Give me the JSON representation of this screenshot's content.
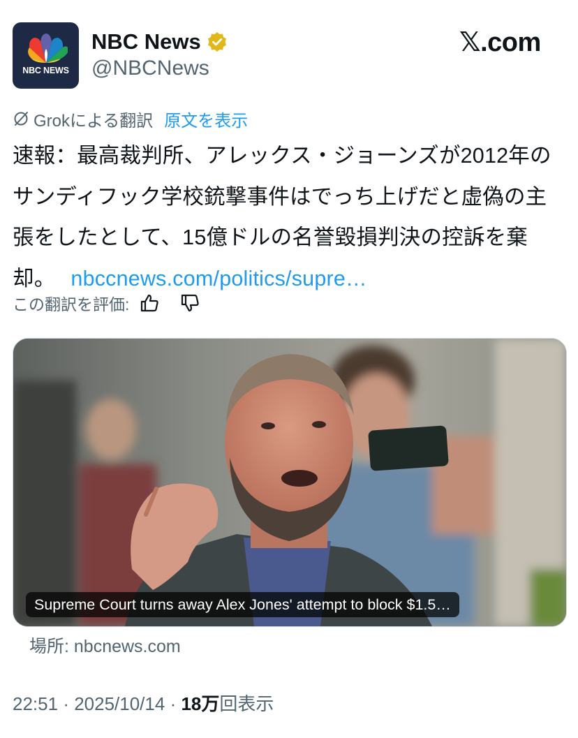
{
  "header": {
    "avatar_text": "NBC NEWS",
    "display_name": "NBC News",
    "handle": "@NBCNews",
    "site": "𝕏.com"
  },
  "translation": {
    "label": "Grokによる翻訳",
    "show_original": "原文を表示"
  },
  "tweet": {
    "text": "速報：最高裁判所、アレックス・ジョーンズが2012年のサンディフック学校銃撃事件はでっち上げだと虚偽の主張をしたとして、15億ドルの名誉毀損判決の控訴を棄却。",
    "link": "nbccnews.com/politics/supre…"
  },
  "rate": {
    "label": "この翻訳を評価:"
  },
  "media": {
    "caption": "Supreme Court turns away Alex Jones' attempt to block $1.5…",
    "source": "場所: nbcnews.com"
  },
  "meta": {
    "time": "22:51",
    "date": "2025/10/14",
    "views_count": "18万",
    "views_label": "回表示"
  },
  "icons": {
    "verified": "verified-badge-icon",
    "grok": "grok-icon",
    "thumbs_up": "thumbs-up-icon",
    "thumbs_down": "thumbs-down-icon",
    "avatar_logo": "nbc-peacock-icon"
  },
  "colors": {
    "link": "#1d9bf0",
    "secondary": "#536471",
    "primary_text": "#0f1419",
    "verified_gold": "#e2b719",
    "avatar_bg": "#1d2945"
  }
}
